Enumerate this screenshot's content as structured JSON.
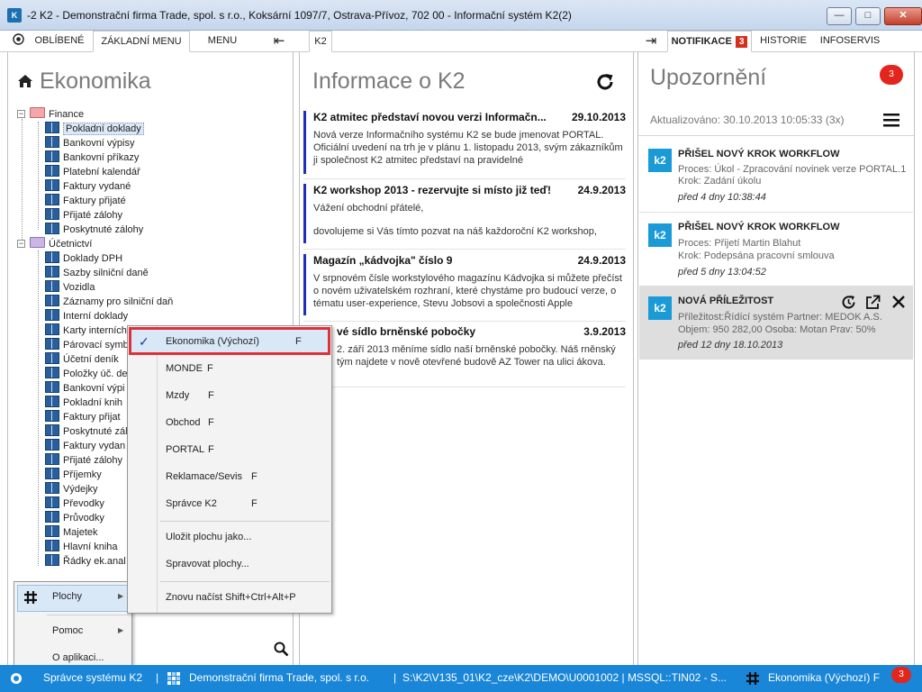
{
  "window": {
    "title": "-2 K2 - Demonstrační firma Trade, spol. s r.o., Koksární 1097/7, Ostrava-Přívoz, 702 00 - Informační systém K2(2)",
    "minimize": "—",
    "maximize": "□",
    "close": "✕"
  },
  "tabs": {
    "left": [
      {
        "label": "OBLÍBENÉ"
      },
      {
        "label": "ZÁKLADNÍ MENU"
      },
      {
        "label": "MENU"
      }
    ],
    "collapse_left_icon": "⇤",
    "center": {
      "label": "K2"
    },
    "collapse_right_icon": "⇥",
    "right": [
      {
        "label": "NOTIFIKACE",
        "badge": "3"
      },
      {
        "label": "HISTORIE"
      },
      {
        "label": "INFOSERVIS"
      }
    ]
  },
  "left_panel": {
    "title": "Ekonomika",
    "groups": [
      {
        "label": "Finance",
        "expander": "−",
        "items": [
          "Pokladní doklady",
          "Bankovní výpisy",
          "Bankovní příkazy",
          "Platební kalendář",
          "Faktury vydané",
          "Faktury přijaté",
          "Přijaté zálohy",
          "Poskytnuté zálohy"
        ]
      },
      {
        "label": "Účetnictví",
        "expander": "−",
        "items": [
          "Doklady DPH",
          "Sazby silniční daně",
          "Vozidla",
          "Záznamy pro silniční daň",
          "Interní doklady",
          "Karty interních",
          "Párovací symb",
          "Účetní deník",
          "Položky úč. de",
          "Bankovní výpi",
          "Pokladní knih",
          "Faktury přijat",
          "Poskytnuté zál",
          "Faktury vydan",
          "Přijaté zálohy",
          "Příjemky",
          "Výdejky",
          "Převodky",
          "Průvodky",
          "Majetek",
          "Hlavní kniha",
          "Řádky ek.anal"
        ]
      }
    ]
  },
  "center_panel": {
    "title": "Informace o K2",
    "news": [
      {
        "title": "K2 atmitec představí novou verzi Informačn...",
        "date": "29.10.2013",
        "body": "Nová verze Informačního systému K2 se bude jmenovat PORTAL. Oficiální uvedení na trh je v plánu 1. listopadu 2013, svým zákazníkům ji společnost K2 atmitec představí na pravidelné"
      },
      {
        "title": "K2 workshop 2013 - rezervujte si místo již teď!",
        "date": "24.9.2013",
        "body": "Vážení obchodní přátelé,",
        "body2": "dovolujeme si Vás tímto pozvat na náš každoroční K2 workshop,"
      },
      {
        "title": "Magazín „kádvojka\" číslo 9",
        "date": "24.9.2013",
        "body": "V srpnovém čísle workstylového magazínu Kádvojka si můžete přečíst o novém uživatelském rozhraní, které chystáme pro budoucí verze, o tématu user-experience, Stevu Jobsovi a společnosti Apple"
      },
      {
        "title": "vé sídlo brněnské pobočky",
        "date": "3.9.2013",
        "body": "2. září 2013 měníme sídlo naší brněnské pobočky. Náš rněnský tým najdete v nově otevřené budově AZ Tower na ulici ákova."
      }
    ]
  },
  "right_panel": {
    "title": "Upozornění",
    "badge": "3",
    "updated": "Aktualizováno: 30.10.2013 10:05:33 (3x)",
    "notifications": [
      {
        "logo": "k2",
        "title": "PŘIŠEL NOVÝ KROK WORKFLOW",
        "line1": "Proces: Úkol - Zpracování novinek verze PORTAL.1",
        "line2": "Krok: Zadání úkolu",
        "date": "před 4 dny 10:38:44"
      },
      {
        "logo": "k2",
        "title": "PŘIŠEL NOVÝ KROK WORKFLOW",
        "line1": "Proces: Přijetí Martin Blahut",
        "line2": "Krok: Podepsána pracovní smlouva",
        "date": "před 5 dny 13:04:52"
      },
      {
        "logo": "k2",
        "title": "NOVÁ PŘÍLEŽITOST",
        "line1": "Příležitost:Řídící systém Partner: MEDOK A.S.",
        "line2": "Objem: 950 282,00 Osoba: Motan Prav: 50%",
        "date": "před 12 dny 18.10.2013"
      }
    ]
  },
  "context_menu": {
    "items": [
      {
        "label": "Plochy",
        "arrow": "▶"
      },
      {
        "label": "Pomoc",
        "arrow": "▶"
      },
      {
        "label": "O aplikaci..."
      }
    ]
  },
  "submenu": {
    "check": "✓",
    "items": [
      {
        "label": "Ekonomika (Výchozí)",
        "shortcut": "F"
      },
      {
        "label": "MONDE",
        "shortcut": "F"
      },
      {
        "label": "Mzdy",
        "shortcut": "F"
      },
      {
        "label": "Obchod",
        "shortcut": "F"
      },
      {
        "label": "PORTAL",
        "shortcut": "F"
      },
      {
        "label": "Reklamace/Sevis",
        "shortcut": "F"
      },
      {
        "label": "Správce K2",
        "shortcut": "F"
      },
      {
        "label": "Uložit plochu jako..."
      },
      {
        "label": "Spravovat plochy..."
      },
      {
        "label": "Znovu načíst Shift+Ctrl+Alt+P"
      }
    ]
  },
  "statusbar": {
    "user": "Správce systému K2",
    "sep1": "|",
    "company": "Demonstrační firma Trade, spol. s r.o.",
    "sep2": "|",
    "path": "S:\\K2\\V135_01\\K2_cze\\K2\\DEMO\\U0001002 | MSSQL::TIN02 - S...",
    "workspace": "Ekonomika (Výchozí) F",
    "badge": "3"
  },
  "colors": {
    "accent": "#1a86d8",
    "news_bar": "#1c2fbf",
    "badge": "#d3311e",
    "highlight": "#e0303a"
  }
}
